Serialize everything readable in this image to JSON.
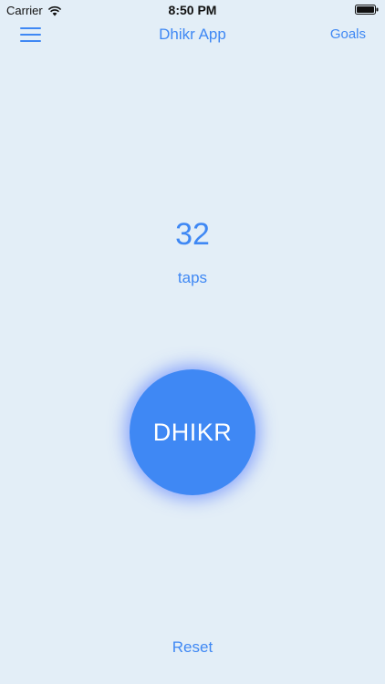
{
  "status_bar": {
    "carrier": "Carrier",
    "time": "8:50 PM",
    "icons": [
      "wifi-icon",
      "battery-icon"
    ]
  },
  "nav": {
    "menu_icon": "hamburger-menu-icon",
    "title": "Dhikr App",
    "goals_label": "Goals"
  },
  "counter": {
    "count": "32",
    "unit_label": "taps"
  },
  "dhikr_button": {
    "label": "DHIKR"
  },
  "reset_label": "Reset",
  "colors": {
    "background": "#e3eef7",
    "accent": "#3f88f4",
    "button_text": "#ffffff"
  }
}
